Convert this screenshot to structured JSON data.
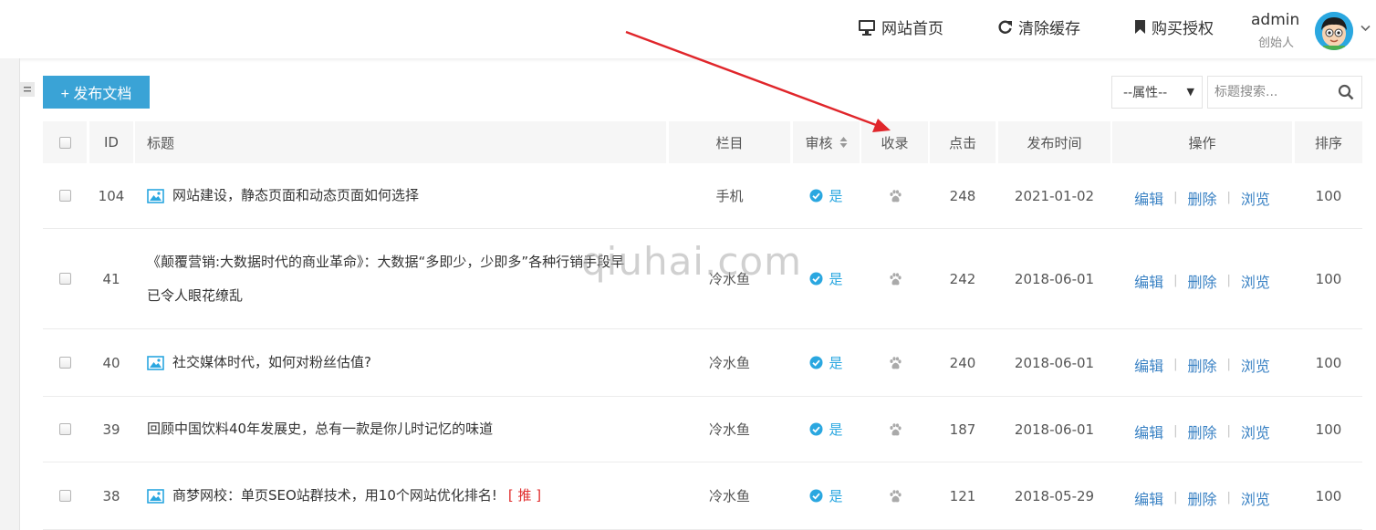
{
  "header": {
    "links": [
      {
        "label": "网站首页",
        "icon": "monitor-icon"
      },
      {
        "label": "清除缓存",
        "icon": "refresh-icon"
      },
      {
        "label": "购买授权",
        "icon": "bookmark-icon"
      }
    ],
    "user": {
      "name": "admin",
      "role": "创始人"
    }
  },
  "toolbar": {
    "publish_label": "+ 发布文档",
    "attribute_select": "--属性--",
    "search_placeholder": "标题搜索..."
  },
  "table": {
    "columns": {
      "id": "ID",
      "title": "标题",
      "category": "栏目",
      "review": "审核",
      "indexed": "收录",
      "clicks": "点击",
      "publish_time": "发布时间",
      "actions": "操作",
      "sort": "排序"
    },
    "action_labels": {
      "edit": "编辑",
      "delete": "删除",
      "view": "浏览"
    },
    "rows": [
      {
        "id": "104",
        "has_image": true,
        "title_lines": [
          "网站建设，静态页面和动态页面如何选择"
        ],
        "tag": "",
        "category": "手机",
        "review": "是",
        "clicks": "248",
        "date": "2021-01-02",
        "sort": "100"
      },
      {
        "id": "41",
        "has_image": false,
        "title_lines": [
          "《颠覆营销:大数据时代的商业革命》：大数据“多即少，少即多”各种行销手段早",
          "已令人眼花缭乱"
        ],
        "tag": "",
        "category": "冷水鱼",
        "review": "是",
        "clicks": "242",
        "date": "2018-06-01",
        "sort": "100"
      },
      {
        "id": "40",
        "has_image": true,
        "title_lines": [
          "社交媒体时代，如何对粉丝估值?"
        ],
        "tag": "",
        "category": "冷水鱼",
        "review": "是",
        "clicks": "240",
        "date": "2018-06-01",
        "sort": "100"
      },
      {
        "id": "39",
        "has_image": false,
        "title_lines": [
          "回顾中国饮料40年发展史，总有一款是你儿时记忆的味道"
        ],
        "tag": "",
        "category": "冷水鱼",
        "review": "是",
        "clicks": "187",
        "date": "2018-06-01",
        "sort": "100"
      },
      {
        "id": "38",
        "has_image": true,
        "title_lines": [
          "商梦网校：单页SEO站群技术，用10个网站优化排名!"
        ],
        "tag": "[ 推 ]",
        "category": "冷水鱼",
        "review": "是",
        "clicks": "121",
        "date": "2018-05-29",
        "sort": "100"
      }
    ]
  },
  "watermark": "qiuhai.com",
  "colors": {
    "accent": "#3aa3d6",
    "status": "#2aa7e0",
    "link": "#3a82c4",
    "tag": "#e02d2d",
    "annotation_arrow": "#e0262b"
  }
}
